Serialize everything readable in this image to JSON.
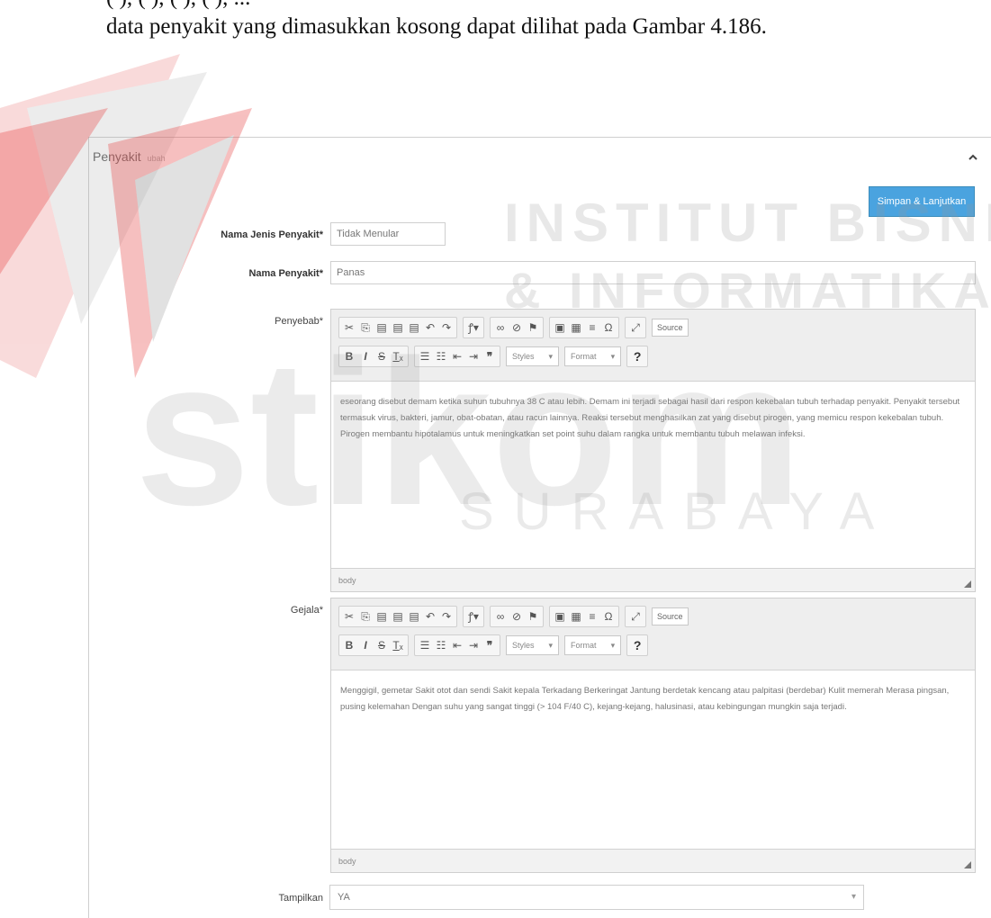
{
  "caption": {
    "top_fragment": "(     ),     (     ),     (     ),     (     ),     ...",
    "line": "data penyakit yang dimasukkan kosong dapat dilihat pada Gambar 4.186."
  },
  "watermark": {
    "line1": "INSTITUT BISNIS",
    "line2": "& INFORMATIKA",
    "logo": "stikom",
    "city": "SURABAYA"
  },
  "panel": {
    "title": "Penyakit",
    "subtitle": "ubah",
    "save_label": "Simpan & Lanjutkan"
  },
  "form": {
    "jenis_label": "Nama Jenis Penyakit*",
    "jenis_value": "Tidak Menular",
    "nama_label": "Nama Penyakit*",
    "nama_value": "Panas",
    "penyebab_label": "Penyebab*",
    "gejala_label": "Gejala*",
    "tampilkan_label": "Tampilkan",
    "tampilkan_value": "YA"
  },
  "editor": {
    "styles_label": "Styles",
    "format_label": "Format",
    "source_label": "Source",
    "status_path": "body"
  },
  "penyebab_text": "eseorang disebut demam ketika suhun tubuhnya 38 C atau lebih. Demam ini terjadi sebagai hasil dari respon kekebalan tubuh terhadap penyakit. Penyakit tersebut termasuk virus, bakteri, jamur, obat-obatan, atau racun lainnya. Reaksi tersebut menghasilkan zat yang disebut pirogen, yang memicu respon kekebalan tubuh. Pirogen membantu hipotalamus untuk meningkatkan set point suhu dalam rangka untuk membantu tubuh melawan infeksi.",
  "gejala_text": "Menggigil, gemetar Sakit otot dan sendi Sakit kepala Terkadang Berkeringat Jantung berdetak kencang atau palpitasi (berdebar) Kulit memerah Merasa pingsan, pusing kelemahan Dengan suhu yang sangat tinggi (> 104 F/40 C), kejang-kejang, halusinasi, atau kebingungan mungkin saja terjadi."
}
